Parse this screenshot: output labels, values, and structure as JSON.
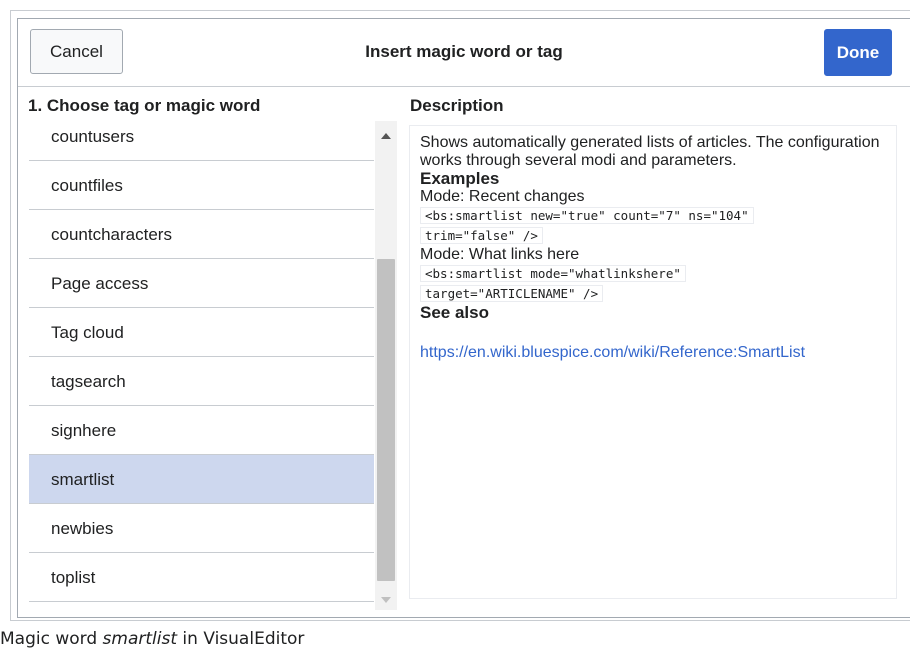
{
  "dialog": {
    "title": "Insert magic word or tag",
    "cancel_label": "Cancel",
    "done_label": "Done"
  },
  "left_panel": {
    "heading": "1. Choose tag or magic word",
    "items": [
      "countusers",
      "countfiles",
      "countcharacters",
      "Page access",
      "Tag cloud",
      "tagsearch",
      "signhere",
      "smartlist",
      "newbies",
      "toplist"
    ],
    "selected": "smartlist"
  },
  "right_panel": {
    "heading": "Description",
    "description": "Shows automatically generated lists of articles. The configuration works through several modi and parameters.",
    "examples_heading": "Examples",
    "example1_mode": "Mode: Recent changes",
    "example1_code_line1": "<bs:smartlist new=\"true\" count=\"7\" ns=\"104\"",
    "example1_code_line2": "trim=\"false\" />",
    "example2_mode": "Mode: What links here",
    "example2_code_line1": "<bs:smartlist mode=\"whatlinkshere\"",
    "example2_code_line2": "target=\"ARTICLENAME\" />",
    "see_also_heading": "See also",
    "see_also_link": "https://en.wiki.bluespice.com/wiki/Reference:SmartList"
  },
  "caption": {
    "prefix": "Magic word ",
    "emph": "smartlist",
    "suffix": " in VisualEditor"
  },
  "colors": {
    "primary": "#3366cc",
    "selected_row": "#cdd7ee",
    "border": "#c8ccd1"
  }
}
